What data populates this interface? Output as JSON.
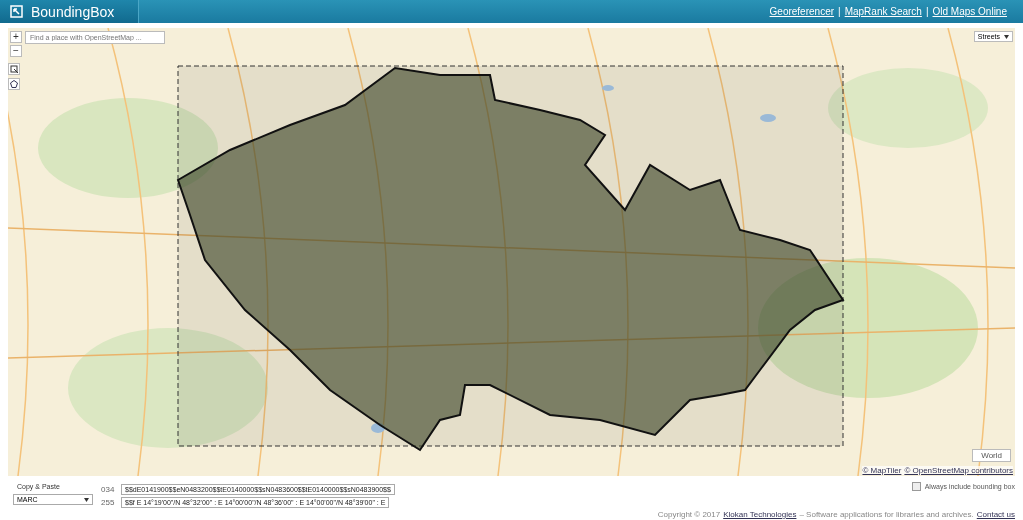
{
  "header": {
    "title": "BoundingBox",
    "links": [
      "Georeferencer",
      "MapRank Search",
      "Old Maps Online"
    ],
    "separators": [
      "|",
      "|"
    ]
  },
  "map": {
    "zoom_in": "+",
    "zoom_out": "−",
    "search": {
      "placeholder": "Find a place with OpenStreetMap ..."
    },
    "layer_select": "Streets",
    "world_button": "World",
    "attribution": [
      "© MapTiler",
      "© OpenStreetMap contributors"
    ]
  },
  "panel": {
    "title": "Copy & Paste",
    "format": "MARC",
    "fields": [
      {
        "label": "034",
        "value": "$$dE0141900$$eN0483200$$tE0140000$$sN0483600$$tE0140000$$sN0483900$$"
      },
      {
        "label": "255",
        "value": "$$f E 14°19'00\"/N 48°32'00\" : E 14°00'00\"/N 48°36'00\" : E 14°00'00\"/N 48°39'00\" : E"
      }
    ],
    "always_include": {
      "label": "Always include bounding box",
      "checked": false
    }
  },
  "footer": {
    "copyright": "Copyright © 2017",
    "company": "Klokan Technologies",
    "tagline": "– Software applications for libraries and archives.",
    "contact": "Contact us"
  }
}
